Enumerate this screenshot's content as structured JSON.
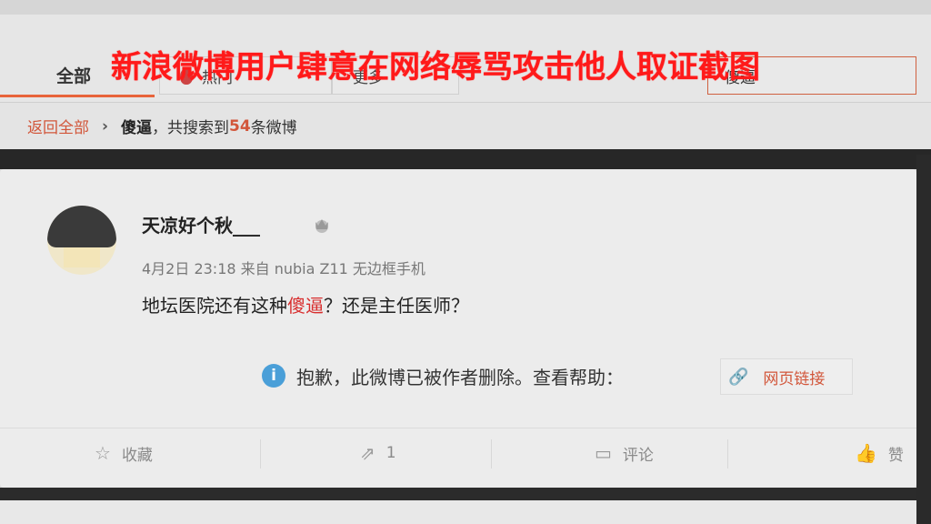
{
  "overlay_title": "新浪微博用户肆意在网络辱骂攻击他人取证截图",
  "tabs": {
    "all": "全部",
    "hot": "热门",
    "more": "更多",
    "search_value": "傻逼"
  },
  "breadcrumb": {
    "back": "返回全部",
    "separator": "›",
    "keyword": "傻逼",
    "result_prefix": "，共搜索到",
    "count": "54",
    "result_suffix": "条微博"
  },
  "post": {
    "username": "天凉好个秋___",
    "meta": "4月2日 23:18 来自 nubia Z11 无边框手机",
    "content_before": "地坛医院还有这种",
    "content_highlight": "傻逼",
    "content_after": "？还是主任医师？",
    "deleted_notice": "抱歉，此微博已被作者删除。查看帮助：",
    "link_label": "网页链接"
  },
  "actions": {
    "favorite": "收藏",
    "share_count": "1",
    "comment": "评论",
    "like": "赞"
  },
  "colors": {
    "accent": "#d2563a",
    "highlight": "#d82e2e",
    "overlay_red": "#ff1a1a",
    "info_blue": "#4a9fd8"
  }
}
